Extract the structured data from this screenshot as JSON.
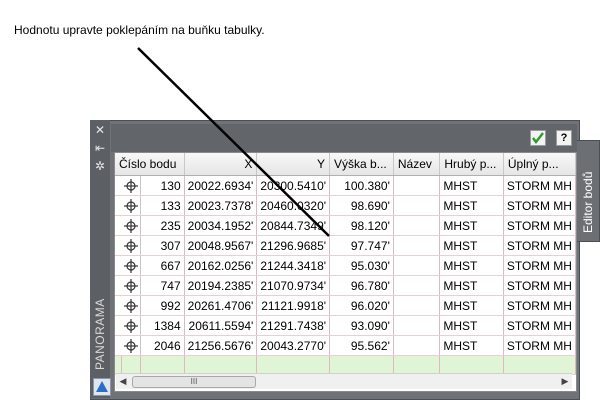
{
  "instruction": "Hodnotu upravte poklepáním na buňku tabulky.",
  "window": {
    "panorama_label": "PANORAMA",
    "side_tab": "Editor bodů",
    "help_button": "?"
  },
  "table": {
    "columns": [
      "Číslo bodu",
      "X",
      "Y",
      "Výška b...",
      "Název",
      "Hrubý p...",
      "Úplný p..."
    ],
    "rows": [
      [
        "130",
        "20022.6934'",
        "20300.5410'",
        "100.380'",
        "",
        "MHST",
        "STORM MH"
      ],
      [
        "133",
        "20023.7378'",
        "20460.0320'",
        "98.690'",
        "",
        "MHST",
        "STORM MH"
      ],
      [
        "235",
        "20034.1952'",
        "20844.7349'",
        "98.120'",
        "",
        "MHST",
        "STORM MH"
      ],
      [
        "307",
        "20048.9567'",
        "21296.9685'",
        "97.747'",
        "",
        "MHST",
        "STORM MH"
      ],
      [
        "667",
        "20162.0256'",
        "21244.3418'",
        "95.030'",
        "",
        "MHST",
        "STORM MH"
      ],
      [
        "747",
        "20194.2385'",
        "21070.9734'",
        "96.780'",
        "",
        "MHST",
        "STORM MH"
      ],
      [
        "992",
        "20261.4706'",
        "21121.9918'",
        "96.020'",
        "",
        "MHST",
        "STORM MH"
      ],
      [
        "1384",
        "20611.5594'",
        "21291.7438'",
        "93.090'",
        "",
        "MHST",
        "STORM MH"
      ],
      [
        "2046",
        "21256.5676'",
        "20043.2770'",
        "95.562'",
        "",
        "MHST",
        "STORM MH"
      ]
    ]
  },
  "scrollbar": {
    "thumb_grip": "III"
  }
}
